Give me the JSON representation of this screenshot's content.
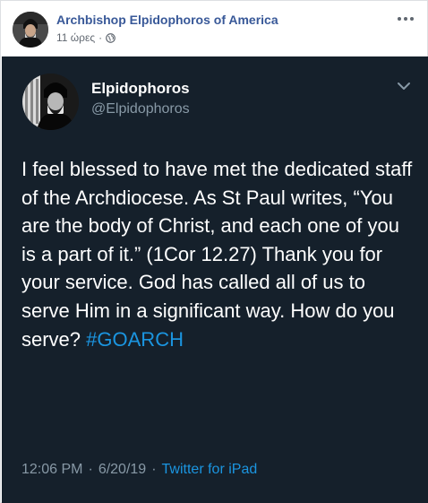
{
  "post": {
    "page_name": "Archbishop Elpidophoros of America",
    "timestamp": "11 ώρες",
    "separator": "·",
    "privacy_icon": "globe-icon",
    "more_icon": "more-options-icon"
  },
  "tweet": {
    "display_name": "Elpidophoros",
    "handle": "@Elpidophoros",
    "chevron_icon": "chevron-down-icon",
    "text": "I feel blessed to have met the dedicated staff of the Archdiocese. As St Paul writes, “You are the body of Christ, and each one of you is a part of it.” (1Cor 12.27) Thank you for your service. God has called all of us to serve Him in a significant way. How do you serve?",
    "hashtag": "#GOARCH",
    "time": "12:06 PM",
    "date_separator": "·",
    "date": "6/20/19",
    "source_separator": "·",
    "source": "Twitter for iPad"
  },
  "colors": {
    "fb_link": "#385898",
    "tweet_bg": "#15202b",
    "tweet_muted": "#8899a6",
    "tweet_link": "#1b95e0"
  }
}
